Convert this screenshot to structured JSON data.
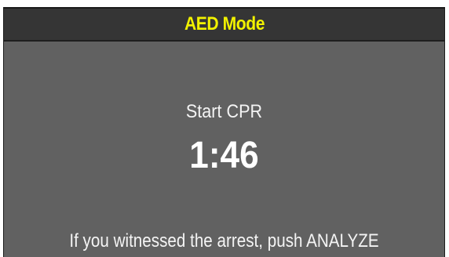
{
  "header": {
    "title": "AED Mode"
  },
  "main": {
    "prompt": "Start CPR",
    "timer": "1:46",
    "instruction": "If you witnessed the arrest, push ANALYZE"
  },
  "colors": {
    "screen_background": "#616161",
    "title_bar_background": "#353535",
    "title_text": "#f2f200",
    "body_text": "#ffffff"
  }
}
